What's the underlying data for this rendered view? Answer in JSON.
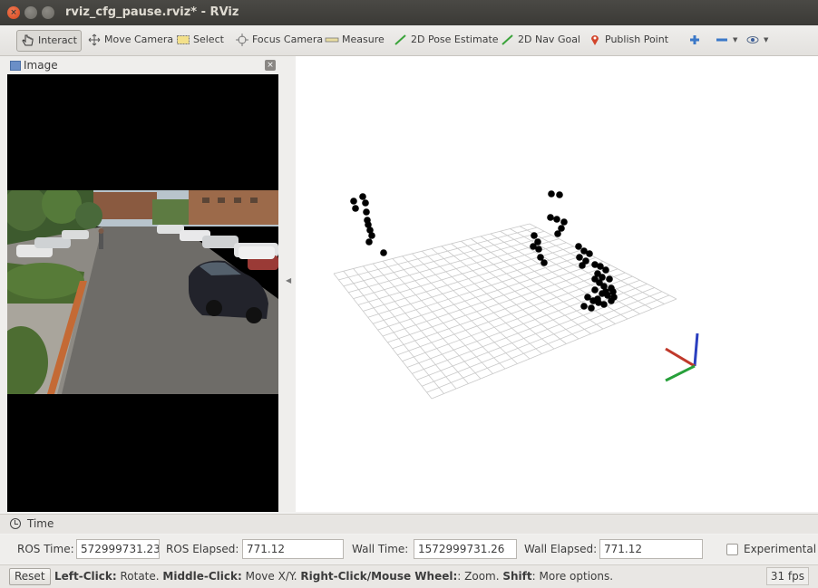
{
  "window": {
    "title": "rviz_cfg_pause.rviz* - RViz",
    "controls": [
      "close",
      "minimize",
      "maximize"
    ]
  },
  "toolbar": {
    "tools": [
      {
        "id": "interact",
        "label": "Interact",
        "icon": "hand-pointer-icon",
        "active": true
      },
      {
        "id": "move_camera",
        "label": "Move Camera",
        "icon": "move-arrows-icon"
      },
      {
        "id": "select",
        "label": "Select",
        "icon": "select-box-icon"
      },
      {
        "id": "focus_camera",
        "label": "Focus Camera",
        "icon": "focus-target-icon"
      },
      {
        "id": "measure",
        "label": "Measure",
        "icon": "ruler-icon"
      },
      {
        "id": "pose_estimate",
        "label": "2D Pose Estimate",
        "icon": "green-arrow-icon"
      },
      {
        "id": "nav_goal",
        "label": "2D Nav Goal",
        "icon": "green-arrow-icon"
      },
      {
        "id": "publish_point",
        "label": "Publish Point",
        "icon": "map-pin-icon"
      }
    ],
    "extra_icons": [
      "add-tool-icon",
      "remove-tool-icon",
      "view-dropdown-icon"
    ]
  },
  "image_panel": {
    "title": "Image",
    "icon": "image-panel-icon",
    "close_icon": "close-icon"
  },
  "view3d": {
    "grid": true,
    "marker_color": "#000000",
    "axes_colors": {
      "x": "#c0392b",
      "y": "#27a03a",
      "z": "#2a3fbf"
    }
  },
  "time_panel": {
    "title": "Time",
    "ros_time_label": "ROS Time:",
    "ros_time": "572999731.23",
    "ros_elapsed_label": "ROS Elapsed:",
    "ros_elapsed": "771.12",
    "wall_time_label": "Wall Time:",
    "wall_time": "1572999731.26",
    "wall_elapsed_label": "Wall Elapsed:",
    "wall_elapsed": "771.12",
    "experimental_label": "Experimental",
    "experimental_checked": false
  },
  "status_bar": {
    "reset_label": "Reset",
    "parts": [
      {
        "text": "Left-Click:",
        "bold": true
      },
      {
        "text": " Rotate. ",
        "bold": false
      },
      {
        "text": "Middle-Click:",
        "bold": true
      },
      {
        "text": " Move X/Y. ",
        "bold": false
      },
      {
        "text": "Right-Click/Mouse Wheel:",
        "bold": true
      },
      {
        "text": ": Zoom. ",
        "bold": false
      },
      {
        "text": "Shift",
        "bold": true
      },
      {
        "text": ": More options.",
        "bold": false
      }
    ],
    "fps": "31 fps"
  }
}
